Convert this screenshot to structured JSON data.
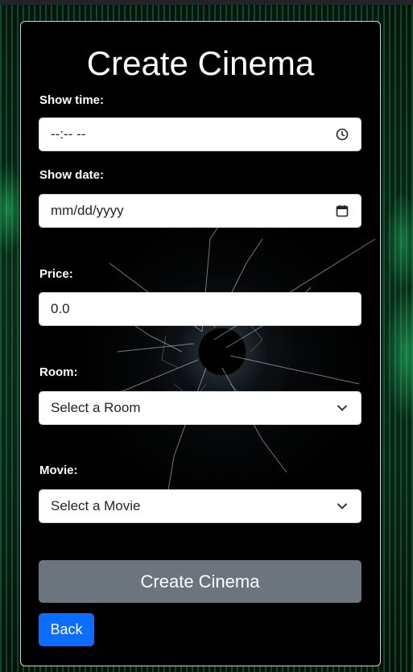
{
  "page": {
    "title": "Create Cinema"
  },
  "form": {
    "show_time": {
      "label": "Show time:",
      "placeholder": "--:-- --"
    },
    "show_date": {
      "label": "Show date:",
      "placeholder": "mm/dd/yyyy"
    },
    "price": {
      "label": "Price:",
      "value": "0.0"
    },
    "room": {
      "label": "Room:",
      "selected": "Select a Room"
    },
    "movie": {
      "label": "Movie:",
      "selected": "Select a Movie"
    }
  },
  "actions": {
    "submit_label": "Create Cinema",
    "back_label": "Back"
  },
  "icons": {
    "time": "clock-icon",
    "date": "calendar-icon",
    "select": "chevron-down-icon"
  },
  "colors": {
    "submit_bg": "#6c757d",
    "back_bg": "#0d6efd",
    "card_bg": "#000000"
  }
}
